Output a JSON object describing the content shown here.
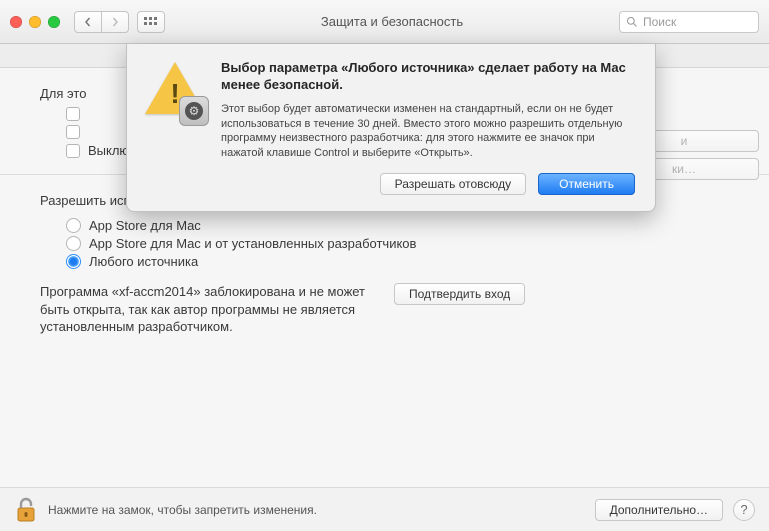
{
  "toolbar": {
    "title": "Защита и безопасность",
    "search_placeholder": "Поиск"
  },
  "login": {
    "section_label": "Для это",
    "cb1": "",
    "cb2": "",
    "cb3": "Выключить автоматический вход",
    "btn1": "и",
    "btn2": "ки…"
  },
  "gatekeeper": {
    "title": "Разрешить использование программ, загруженных из:",
    "opt1": "App Store для Mac",
    "opt2": "App Store для Mac и от установленных разработчиков",
    "opt3": "Любого источника",
    "blocked_text": "Программа «xf-accm2014» заблокирована и не может быть открыта, так как автор программы не является установленным разработчиком.",
    "confirm_btn": "Подтвердить вход"
  },
  "footer": {
    "lock_text": "Нажмите на замок, чтобы запретить изменения.",
    "advanced": "Дополнительно…",
    "help": "?"
  },
  "sheet": {
    "heading": "Выбор параметра «Любого источника» сделает работу на Мас менее безопасной.",
    "body": "Этот выбор будет автоматически изменен на стандартный, если он не будет использоваться в течение 30 дней. Вместо этого можно разрешить отдельную программу неизвестного разработчика: для этого нажмите ее значок при нажатой клавише Control и выберите «Открыть».",
    "allow": "Разрешать отовсюду",
    "cancel": "Отменить"
  }
}
